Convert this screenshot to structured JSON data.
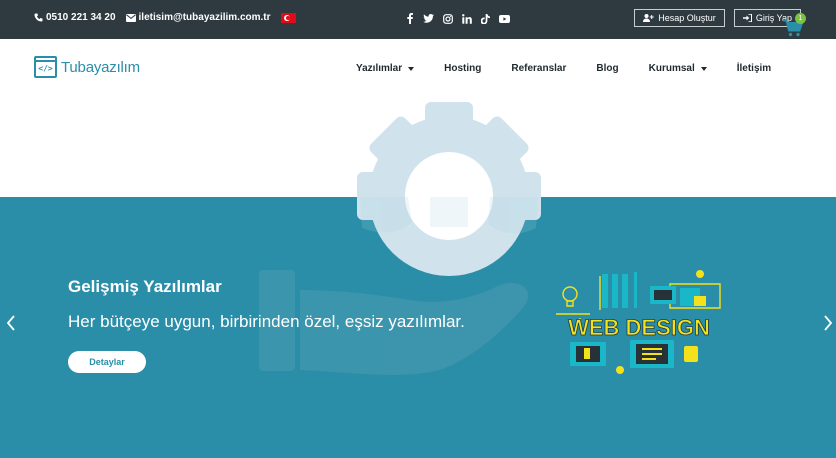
{
  "topbar": {
    "phone": "0510 221 34 20",
    "email": "iletisim@tubayazilim.com.tr",
    "social_icons": [
      "facebook-icon",
      "twitter-icon",
      "instagram-icon",
      "linkedin-icon",
      "tiktok-icon",
      "youtube-icon"
    ],
    "register_label": "Hesap Oluştur",
    "login_label": "Giriş Yap"
  },
  "header": {
    "logo_code": "</>",
    "logo_text": "Tubayazılım",
    "nav": [
      {
        "label": "Yazılımlar",
        "dropdown": true
      },
      {
        "label": "Hosting",
        "dropdown": false
      },
      {
        "label": "Referanslar",
        "dropdown": false
      },
      {
        "label": "Blog",
        "dropdown": false
      },
      {
        "label": "Kurumsal",
        "dropdown": true
      },
      {
        "label": "İletişim",
        "dropdown": false
      }
    ],
    "cart_count": "1"
  },
  "hero": {
    "title": "Gelişmiş Yazılımlar",
    "subtitle": "Her bütçeye uygun, birbirinden özel, eşsiz yazılımlar.",
    "button_label": "Detaylar",
    "image_text": "WEB DESIGN"
  },
  "colors": {
    "topbar_bg": "#2f3a40",
    "accent": "#2a8ea8",
    "badge": "#7cc242",
    "webdesign_yellow": "#f4e11b"
  }
}
